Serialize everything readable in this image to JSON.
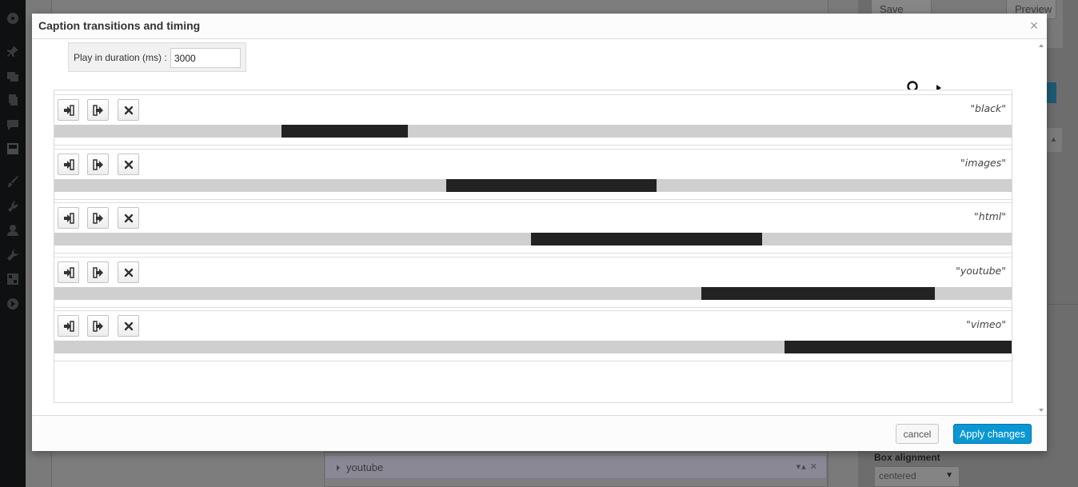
{
  "background": {
    "buttons": {
      "save_draft": "Save Draft",
      "preview": "Preview"
    },
    "list_item_label": "youtube",
    "list_item_controls": "▾▴ ✕",
    "box_alignment_label": "Box alignment",
    "box_alignment_value": "centered"
  },
  "dialog": {
    "title": "Caption transitions and timing",
    "close_glyph": "×",
    "duration_label": "Play in duration (ms) :",
    "duration_value": "3000",
    "cancel_label": "cancel",
    "apply_label": "Apply changes"
  },
  "captions": [
    {
      "name": "\"black\"",
      "start_pct": 23.7,
      "end_pct": 36.9
    },
    {
      "name": "\"images\"",
      "start_pct": 40.9,
      "end_pct": 62.9
    },
    {
      "name": "\"html\"",
      "start_pct": 49.8,
      "end_pct": 73.9
    },
    {
      "name": "\"youtube\"",
      "start_pct": 67.6,
      "end_pct": 92.0
    },
    {
      "name": "\"vimeo\"",
      "start_pct": 76.3,
      "end_pct": 100.0
    }
  ],
  "colors": {
    "accent": "#0a97d3",
    "bar_fill": "#222222",
    "bar_track": "#cfcfcf"
  }
}
